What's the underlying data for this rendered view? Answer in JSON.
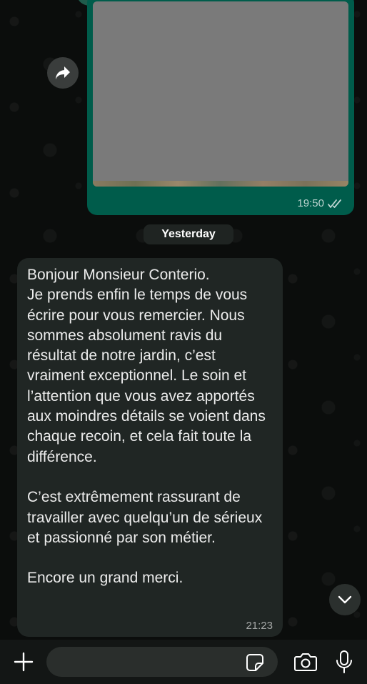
{
  "chat": {
    "outgoing_image_message": {
      "time": "19:50",
      "status_icon": "double-check-icon"
    },
    "date_separator": "Yesterday",
    "incoming_message": {
      "text": "Bonjour Monsieur Conterio.\nJe prends enfin le temps de vous écrire pour vous remercier. Nous sommes absolument ravis du résultat de notre jardin, c’est vraiment exceptionnel. Le soin et l’attention que vous avez apportés aux moindres détails se voient dans chaque recoin, et cela fait toute la différence.\n\nC’est extrêmement rassurant de travailler avec quelqu’un de sérieux et passionné par son métier.\n\nEncore un grand merci.",
      "time": "21:23"
    }
  },
  "input_bar": {
    "message_value": "",
    "icons": {
      "attach": "plus-icon",
      "sticker": "sticker-icon",
      "camera": "camera-icon",
      "mic": "microphone-icon"
    }
  },
  "colors": {
    "outgoing_bubble": "#005c4b",
    "incoming_bubble": "#202624",
    "background": "#0b0d0c",
    "date_pill": "#1f2422"
  }
}
